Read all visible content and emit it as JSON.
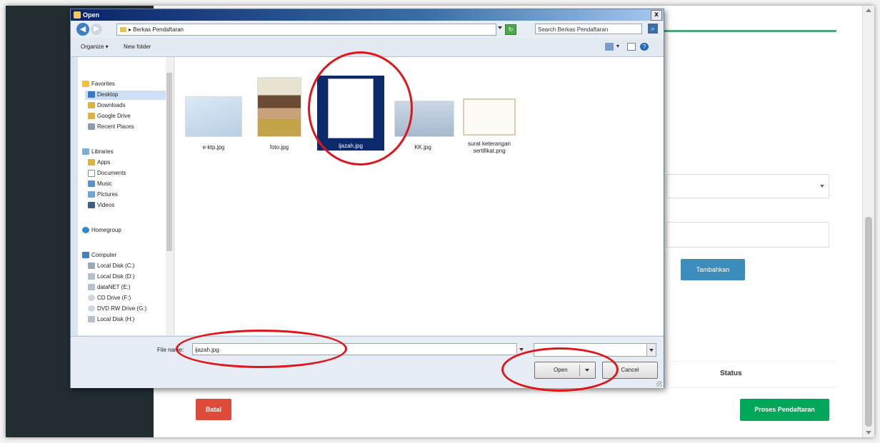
{
  "background_page": {
    "add_button": "Tambahkan",
    "status_header": "Status",
    "cancel_button": "Batal",
    "submit_button": "Proses Pendaftaran"
  },
  "dialog": {
    "title": "Open",
    "address": "Berkas Pendaftaran",
    "search_placeholder": "Search Berkas Pendaftaran",
    "toolbar": {
      "organize": "Organize ▾",
      "new_folder": "New folder"
    },
    "nav": {
      "favorites": "Favorites",
      "desktop": "Desktop",
      "downloads": "Downloads",
      "google_drive": "Google Drive",
      "recent_places": "Recent Places",
      "libraries": "Libraries",
      "apps": "Apps",
      "documents": "Documents",
      "music": "Music",
      "pictures": "Pictures",
      "videos": "Videos",
      "homegroup": "Homegroup",
      "computer": "Computer",
      "disk_c": "Local Disk (C:)",
      "disk_d": "Local Disk (D:)",
      "datanet": "dataNET (E:)",
      "cd_drive": "CD Drive (F:)",
      "dvd_drive": "DVD RW Drive (G:)",
      "disk_h": "Local Disk (H:)"
    },
    "files": [
      {
        "name": "e-ktp.jpg"
      },
      {
        "name": "foto.jpg"
      },
      {
        "name": "ijazah.jpg"
      },
      {
        "name": "KK.jpg"
      },
      {
        "name": "surat keterangan sertifikat.png"
      }
    ],
    "file_name_label": "File name:",
    "file_name_value": "ijazah.jpg",
    "open_button": "Open",
    "cancel_button": "Cancel",
    "close_glyph": "x"
  },
  "colors": {
    "annotation": "#e0141b",
    "add_button": "#3c8dbc",
    "cancel_button": "#dd4b39",
    "submit_button": "#00a65a",
    "accent_rule": "#4aa878"
  }
}
